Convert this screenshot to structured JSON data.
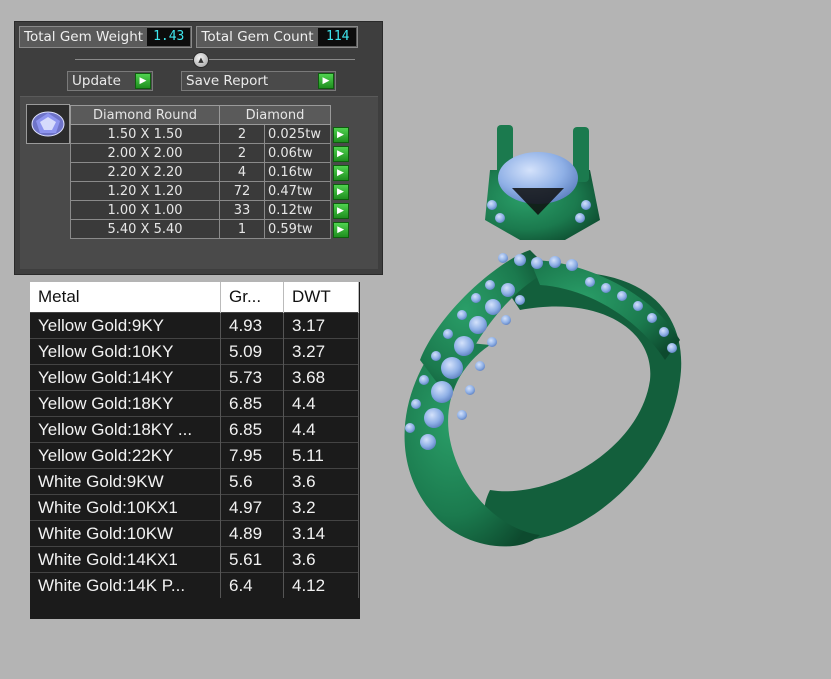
{
  "gem_panel": {
    "total_weight_label": "Total Gem Weight",
    "total_weight_value": "1.43",
    "total_count_label": "Total Gem Count",
    "total_count_value": "114",
    "update_label": "Update",
    "save_report_label": "Save Report",
    "thumbnail_icon": "round-diamond-icon",
    "headers": [
      "Diamond Round",
      "Diamond"
    ],
    "rows": [
      {
        "size": "1.50 X 1.50",
        "qty": "2",
        "tw": "0.025tw"
      },
      {
        "size": "2.00 X 2.00",
        "qty": "2",
        "tw": "0.06tw"
      },
      {
        "size": "2.20 X 2.20",
        "qty": "4",
        "tw": "0.16tw"
      },
      {
        "size": "1.20 X 1.20",
        "qty": "72",
        "tw": "0.47tw"
      },
      {
        "size": "1.00 X 1.00",
        "qty": "33",
        "tw": "0.12tw"
      },
      {
        "size": "5.40 X 5.40",
        "qty": "1",
        "tw": "0.59tw"
      }
    ]
  },
  "metal_table": {
    "headers": [
      "Metal",
      "Gr...",
      "DWT"
    ],
    "rows": [
      {
        "metal": "Yellow Gold:9KY",
        "gr": "4.93",
        "dwt": "3.17"
      },
      {
        "metal": "Yellow Gold:10KY",
        "gr": "5.09",
        "dwt": "3.27"
      },
      {
        "metal": "Yellow Gold:14KY",
        "gr": "5.73",
        "dwt": "3.68"
      },
      {
        "metal": "Yellow Gold:18KY",
        "gr": "6.85",
        "dwt": "4.4"
      },
      {
        "metal": "Yellow Gold:18KY ...",
        "gr": "6.85",
        "dwt": "4.4"
      },
      {
        "metal": "Yellow Gold:22KY",
        "gr": "7.95",
        "dwt": "5.11"
      },
      {
        "metal": "White Gold:9KW",
        "gr": "5.6",
        "dwt": "3.6"
      },
      {
        "metal": "White Gold:10KX1",
        "gr": "4.97",
        "dwt": "3.2"
      },
      {
        "metal": "White Gold:10KW",
        "gr": "4.89",
        "dwt": "3.14"
      },
      {
        "metal": "White Gold:14KX1",
        "gr": "5.61",
        "dwt": "3.6"
      },
      {
        "metal": "White Gold:14K P...",
        "gr": "6.4",
        "dwt": "4.12"
      }
    ]
  },
  "colors": {
    "ring_metal": "#1b7a4e",
    "gem_blue": "#8fb0e6",
    "value_cyan": "#3fe6ee",
    "arrow_green": "#2fb52f"
  },
  "viewport_icon": "ring-3d-model"
}
